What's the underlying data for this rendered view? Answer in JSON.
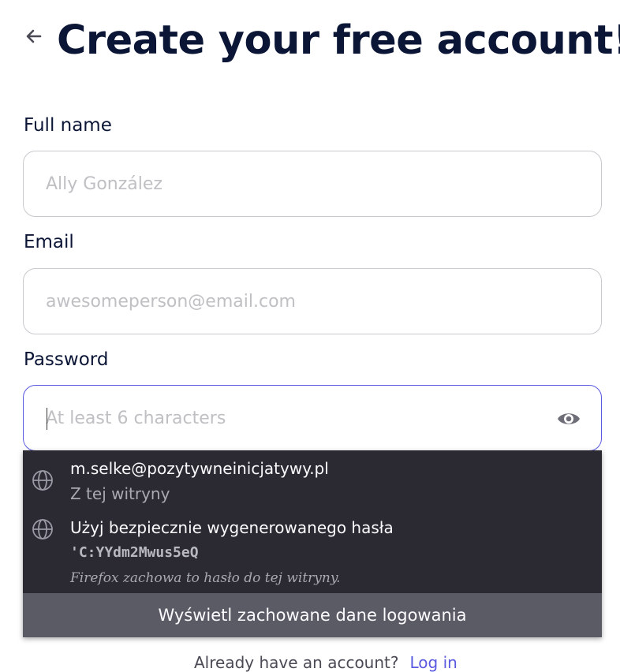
{
  "page": {
    "title": "Create your free account!"
  },
  "icons": {
    "back": "arrow-left-icon",
    "eye": "eye-icon",
    "globe": "globe-icon"
  },
  "form": {
    "full_name": {
      "label": "Full name",
      "value": "",
      "placeholder": "Ally González"
    },
    "email": {
      "label": "Email",
      "value": "",
      "placeholder": "awesomeperson@email.com"
    },
    "password": {
      "label": "Password",
      "value": "",
      "placeholder": "At least 6 characters"
    }
  },
  "autocomplete": {
    "login_item": {
      "primary": "m.selke@pozytywneinicjatywy.pl",
      "secondary": "Z tej witryny"
    },
    "generate_item": {
      "primary": "Użyj bezpiecznie wygenerowanego hasła",
      "password": "'C:YYdm2Mwus5eQ",
      "note": "Firefox zachowa to hasło do tej witryny."
    },
    "footer": "Wyświetl zachowane dane logowania"
  },
  "login_prompt": {
    "text": "Already have an account?",
    "link": "Log in"
  },
  "colors": {
    "heading": "#0b1535",
    "accent": "#5a5ae0",
    "popup_bg": "#2b2a33",
    "popup_footer": "#5b5b66"
  }
}
